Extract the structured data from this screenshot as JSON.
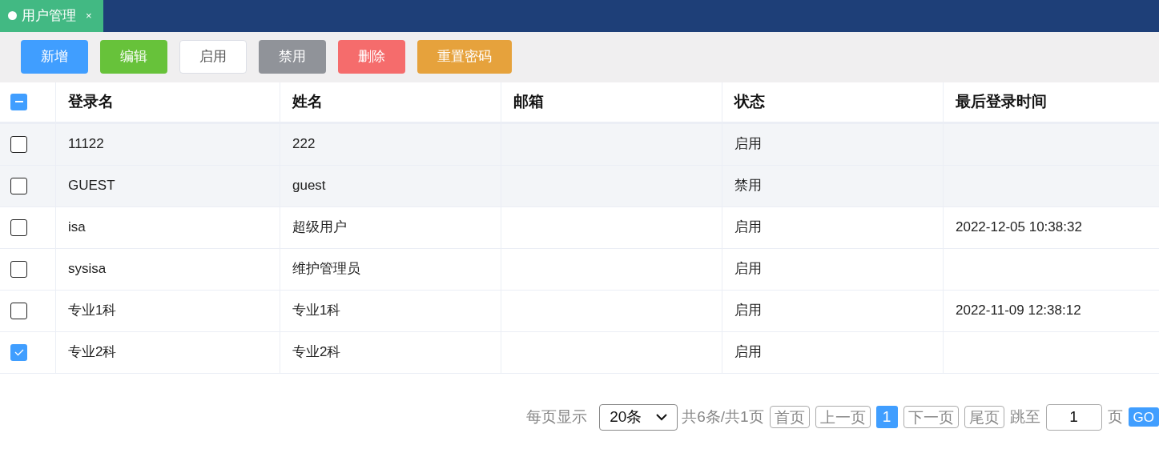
{
  "tabs": [
    {
      "label": "用户管理",
      "close": "×",
      "selected": true
    }
  ],
  "toolbar": [
    {
      "label": "新增",
      "kind": "solid",
      "color": "#409eff"
    },
    {
      "label": "编辑",
      "kind": "solid",
      "color": "#67c23a"
    },
    {
      "label": "启用",
      "kind": "plain",
      "color": "#ffffff"
    },
    {
      "label": "禁用",
      "kind": "solid",
      "color": "#909399"
    },
    {
      "label": "删除",
      "kind": "solid",
      "color": "#f56c6c"
    },
    {
      "label": "重置密码",
      "kind": "solid",
      "color": "#e6a23c"
    }
  ],
  "table": {
    "select_all": {
      "indeterminate": true
    },
    "columns": [
      "登录名",
      "姓名",
      "邮箱",
      "状态",
      "最后登录时间"
    ],
    "rows": [
      {
        "checked": false,
        "shaded": true,
        "cells": [
          "11122",
          "222",
          "",
          "启用",
          ""
        ]
      },
      {
        "checked": false,
        "shaded": true,
        "cells": [
          "GUEST",
          "guest",
          "",
          "禁用",
          ""
        ]
      },
      {
        "checked": false,
        "shaded": false,
        "cells": [
          "isa",
          "超级用户",
          "",
          "启用",
          "2022-12-05 10:38:32"
        ]
      },
      {
        "checked": false,
        "shaded": false,
        "cells": [
          "sysisa",
          "维护管理员",
          "",
          "启用",
          ""
        ]
      },
      {
        "checked": false,
        "shaded": false,
        "cells": [
          "专业1科",
          "专业1科",
          "",
          "启用",
          "2022-11-09 12:38:12"
        ]
      },
      {
        "checked": true,
        "shaded": false,
        "cells": [
          "专业2科",
          "专业2科",
          "",
          "启用",
          ""
        ]
      }
    ]
  },
  "pagination": {
    "page_size_label": "每页显示",
    "page_size": "20条",
    "summary": "共6条/共1页",
    "first": "首页",
    "prev": "上一页",
    "pages": [
      {
        "label": "1",
        "selected": true
      }
    ],
    "next": "下一页",
    "last": "尾页",
    "jump_label": "跳至",
    "jump_value": "1",
    "page_unit": "页",
    "go": "GO"
  }
}
